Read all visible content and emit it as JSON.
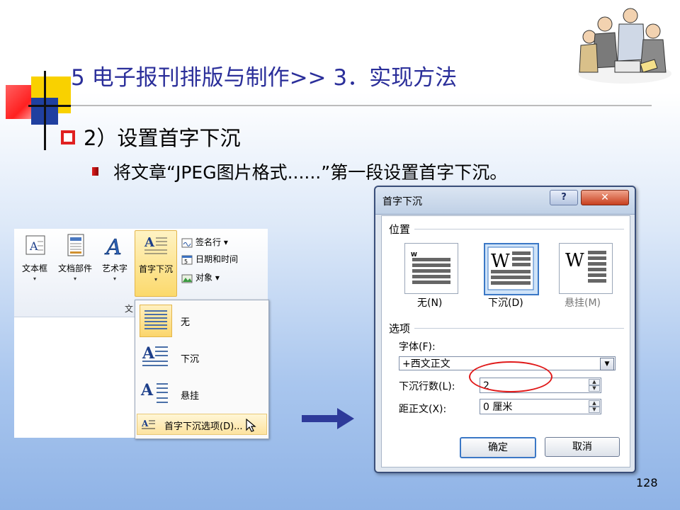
{
  "slide": {
    "title": "5 电子报刊排版与制作>> 3．实现方法",
    "heading": "2）设置首字下沉",
    "body_line": "将文章“JPEG图片格式......”第一段设置首字下沉。",
    "page_number": "128"
  },
  "ribbon": {
    "buttons": [
      {
        "label": "文本框",
        "icon": "text-box-icon"
      },
      {
        "label": "文档部件",
        "icon": "document-parts-icon"
      },
      {
        "label": "艺术字",
        "icon": "wordart-icon"
      },
      {
        "label": "首字下沉",
        "icon": "drop-cap-icon"
      }
    ],
    "small_buttons": [
      {
        "label": "签名行 ▾",
        "icon": "signature-line-icon"
      },
      {
        "label": "日期和时间",
        "icon": "date-time-icon"
      },
      {
        "label": "对象 ▾",
        "icon": "object-icon"
      }
    ],
    "group_label": "文"
  },
  "dropcap_menu": {
    "items": [
      {
        "label": "无"
      },
      {
        "label": "下沉"
      },
      {
        "label": "悬挂"
      }
    ],
    "options_label": "首字下沉选项(D)..."
  },
  "dialog": {
    "title": "首字下沉",
    "help": "?",
    "close": "✕",
    "position_section": "位置",
    "positions": [
      {
        "label": "无(N)"
      },
      {
        "label": "下沉(D)"
      },
      {
        "label": "悬挂(M)"
      }
    ],
    "options_section": "选项",
    "font_label": "字体(F):",
    "font_value": "+西文正文",
    "lines_label": "下沉行数(L):",
    "lines_value": "2",
    "distance_label": "距正文(X):",
    "distance_value": "0 厘米",
    "ok": "确定",
    "cancel": "取消"
  },
  "colors": {
    "title": "#2b2f9a",
    "bullet": "#e02020",
    "arrow": "#2e3a9a"
  }
}
